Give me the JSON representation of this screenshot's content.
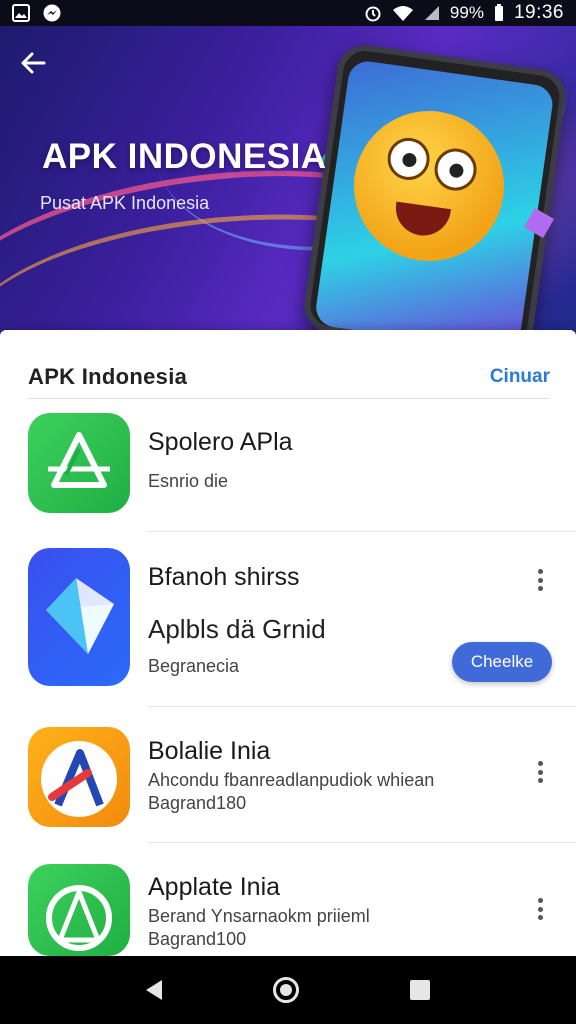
{
  "status_bar": {
    "battery": "99%",
    "time": "19:36"
  },
  "hero": {
    "title": "APK INDONESIA",
    "subtitle": "Pusat APK Indonesia"
  },
  "section": {
    "title": "APK Indonesia",
    "action": "Cinuar"
  },
  "apps": [
    {
      "name": "Spolero APla",
      "line1": "Esnrio die",
      "icon": "green-a-icon"
    },
    {
      "name": "Bfanoh shirss",
      "tagline": "Aplbls dä Grnid",
      "line1": "Begranecia",
      "button": "Cheelke",
      "icon": "blue-play-icon"
    },
    {
      "name": "Bolalie Inia",
      "line1": "Ahcondu fbanreadlanpudiok whiean",
      "line2": "Bagrand180",
      "icon": "orange-a-icon"
    },
    {
      "name": "Applate Inia",
      "line1": "Berand Ynsarnaokm priieml",
      "line2": "Bagrand100",
      "icon": "green-a-icon"
    }
  ],
  "colors": {
    "accent": "#3f6ad8",
    "link": "#2a7bd6",
    "hero_start": "#1d1b6e",
    "hero_end": "#5a2bc4"
  }
}
